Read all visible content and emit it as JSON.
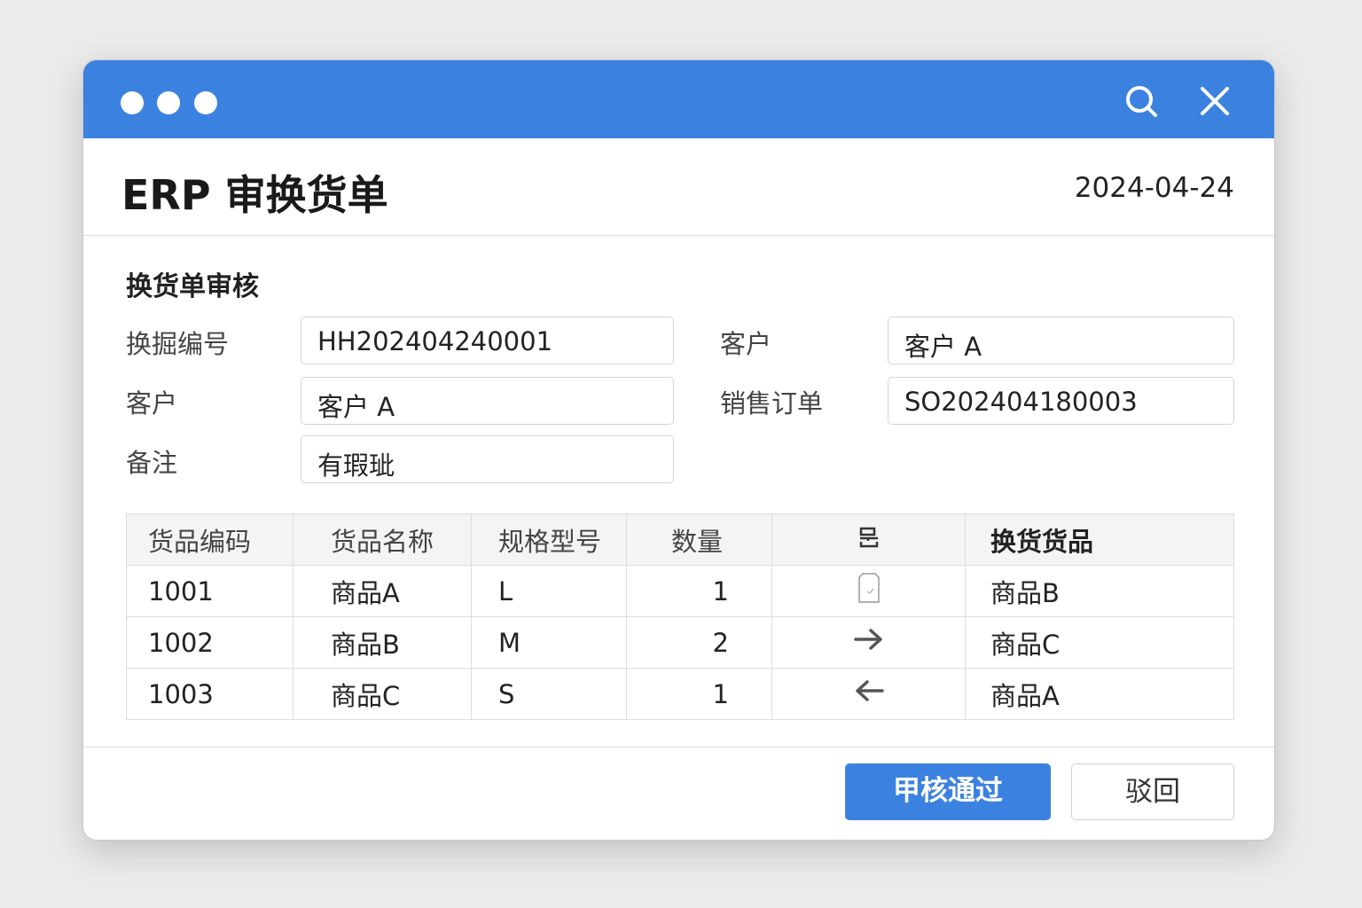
{
  "window": {
    "title": "ERP 审换货单",
    "date": "2024-04-24"
  },
  "section_title": "换货单审核",
  "form": {
    "exchange_no": {
      "label": "换掘编号",
      "value": "HH202404240001"
    },
    "customer_right": {
      "label": "客户",
      "value": "客户 A"
    },
    "customer": {
      "label": "客户",
      "value": "客户 A"
    },
    "sales_order": {
      "label": "销售订单",
      "value": "SO202404180003"
    },
    "remark": {
      "label": "备注",
      "value": "有瑕玼"
    }
  },
  "table": {
    "headers": [
      "货品编码",
      "货品名称",
      "规格型号",
      "数量",
      "",
      "换货货品"
    ],
    "rows": [
      {
        "code": "1001",
        "name": "商品A",
        "spec": "L",
        "qty": "1",
        "icon": "document-check-icon",
        "exchange": "商品B"
      },
      {
        "code": "1002",
        "name": "商品B",
        "spec": "M",
        "qty": "2",
        "icon": "arrow-right-icon",
        "exchange": "商品C"
      },
      {
        "code": "1003",
        "name": "商品C",
        "spec": "S",
        "qty": "1",
        "icon": "arrow-left-icon",
        "exchange": "商品A"
      }
    ]
  },
  "buttons": {
    "approve": "甲核通过",
    "reject": "驳回"
  },
  "colors": {
    "accent": "#3b82e0"
  }
}
